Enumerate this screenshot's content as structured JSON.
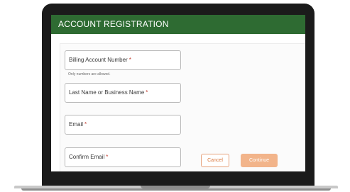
{
  "header": {
    "title": "ACCOUNT REGISTRATION"
  },
  "form": {
    "billing_account_number": {
      "label": "Billing Account Number",
      "required_mark": "*",
      "help_text": "Only numbers are allowed."
    },
    "last_name_or_business_name": {
      "label": "Last Name or Business Name",
      "required_mark": "*"
    },
    "email": {
      "label": "Email",
      "required_mark": "*"
    },
    "confirm_email": {
      "label": "Confirm Email",
      "required_mark": "*"
    }
  },
  "actions": {
    "cancel_label": "Cancel",
    "continue_label": "Continue"
  },
  "colors": {
    "header_green": "#2e6b32",
    "required_red": "#c0392b",
    "cancel_orange": "#d9773d",
    "continue_orange": "#f2b48a"
  }
}
